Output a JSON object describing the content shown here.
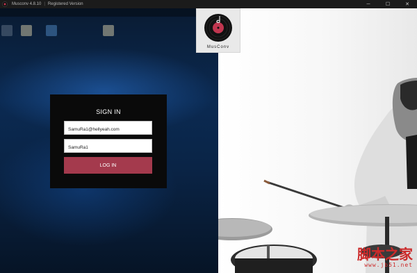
{
  "titlebar": {
    "app_title": "Musconv 4.8.10",
    "registration": "Registered Version",
    "controls": [
      "─",
      "☐",
      "✕"
    ]
  },
  "desktop": {
    "icon_names": [
      "document-icon",
      "document-icon",
      "app-icon",
      "document-icon"
    ]
  },
  "logo": {
    "text": "MusConv"
  },
  "login": {
    "title": "SIGN IN",
    "email_value": "SamuRa1@hellyeah.com",
    "password_value": "SamuRa1",
    "button_label": "LOG IN"
  },
  "colors": {
    "accent": "#a43a4d",
    "card_bg": "#0a0a0a",
    "titlebar_bg": "#1b1b1b",
    "watermark": "#cc2a2a"
  },
  "watermark": {
    "text": "脚本之家",
    "url": "www.jb51.net"
  }
}
